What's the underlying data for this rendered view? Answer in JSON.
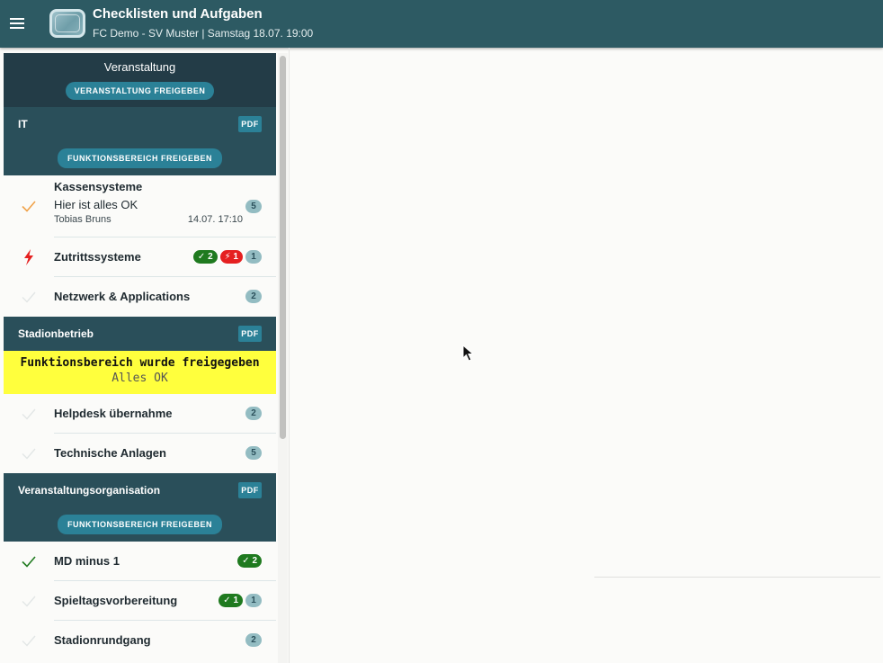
{
  "app": {
    "title": "Checklisten und Aufgaben",
    "subtitle": "FC Demo - SV Muster | Samstag 18.07. 19:00"
  },
  "event": {
    "title": "Veranstaltung",
    "release_label": "VERANSTALTUNG FREIGEBEN"
  },
  "colors": {
    "appbar": "#2d5a63",
    "header_dark": "#233c47",
    "section": "#2a4f5a",
    "accent": "#2b8197",
    "done_green": "#1f7a1f",
    "alert_red": "#e52020",
    "highlight_yellow": "#ffff3d"
  },
  "sections": [
    {
      "title": "IT",
      "pdf_label": "PDF",
      "release_label": "FUNKTIONSBEREICH FREIGEBEN",
      "items": [
        {
          "name": "Kassensysteme",
          "comment": "Hier ist alles OK",
          "author": "Tobias Bruns",
          "time": "14.07. 17:10",
          "status_icon": "check-icon",
          "count": "5"
        },
        {
          "name": "Zutrittssysteme",
          "status_icon": "lightning-icon",
          "done": "✓ 2",
          "alerts": "⚡ 1",
          "count": "1"
        },
        {
          "name": "Netzwerk & Applications",
          "status_icon": "check-icon",
          "count": "2"
        }
      ]
    },
    {
      "title": "Stadionbetrieb",
      "pdf_label": "PDF",
      "released_title": "Funktionsbereich wurde freigegeben",
      "released_sub": "Alles OK",
      "items": [
        {
          "name": "Helpdesk übernahme",
          "status_icon": "check-icon",
          "count": "2"
        },
        {
          "name": "Technische Anlagen",
          "status_icon": "check-icon",
          "count": "5"
        }
      ]
    },
    {
      "title": "Veranstaltungsorganisation",
      "pdf_label": "PDF",
      "release_label": "FUNKTIONSBEREICH FREIGEBEN",
      "items": [
        {
          "name": "MD minus 1",
          "status_icon": "check-icon",
          "done": "✓ 2"
        },
        {
          "name": "Spieltagsvorbereitung",
          "status_icon": "check-icon",
          "done": "✓ 1",
          "count": "1"
        },
        {
          "name": "Stadionrundgang",
          "status_icon": "check-icon",
          "count": "2"
        }
      ]
    }
  ]
}
